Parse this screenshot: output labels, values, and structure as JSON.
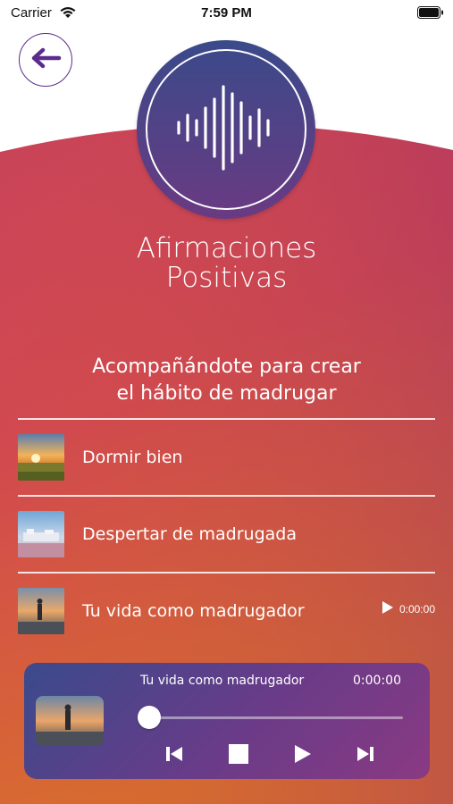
{
  "status_bar": {
    "carrier": "Carrier",
    "time": "7:59 PM",
    "battery_level": 1.0
  },
  "header": {
    "back_icon": "arrow-left-icon",
    "logo_icon": "sound-wave-icon"
  },
  "title": {
    "line1": "Afirmaciones",
    "line2": "Positivas"
  },
  "subtitle": {
    "line1": "Acompañándote para crear",
    "line2": "el hábito de madrugar"
  },
  "tracks": [
    {
      "label": "Dormir bien",
      "thumb": "sunset-field"
    },
    {
      "label": "Despertar de madrugada",
      "thumb": "seaside-town"
    },
    {
      "label": "Tu vida como madrugador",
      "thumb": "person-coast",
      "time": "0:00:00",
      "icon": "play-icon"
    }
  ],
  "player": {
    "title": "Tu vida como madrugador",
    "time": "0:00:00",
    "progress": 0,
    "controls": [
      "skip-back-icon",
      "stop-icon",
      "play-icon",
      "skip-forward-icon"
    ]
  },
  "colors": {
    "accent_purple": "#5b2c8e",
    "gradient_top": "#d8474f",
    "gradient_bottom": "#d86a30",
    "gradient_right": "#b43a5c"
  }
}
